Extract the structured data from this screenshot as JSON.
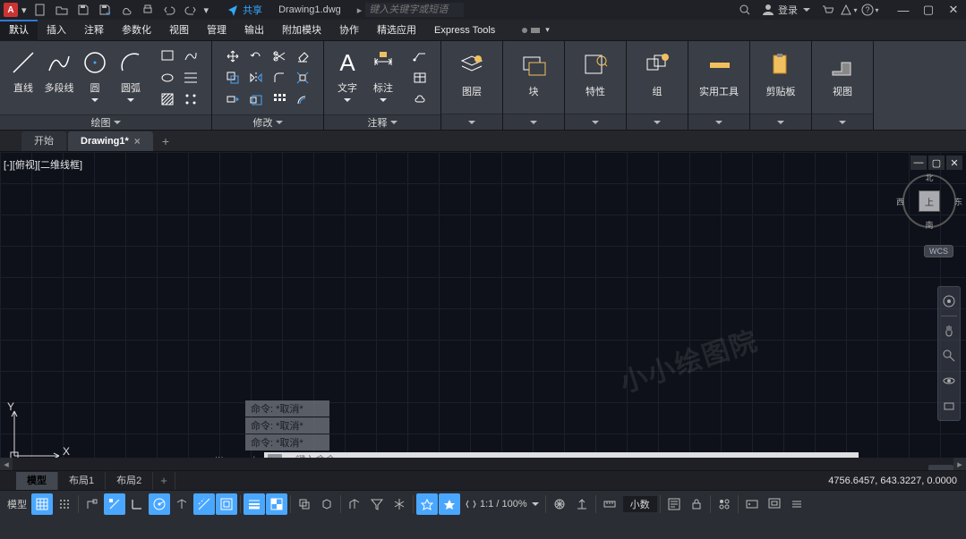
{
  "title": {
    "filename": "Drawing1.dwg",
    "share": "共享",
    "search_placeholder": "键入关键字或短语",
    "login": "登录"
  },
  "menu": {
    "tabs": [
      "默认",
      "插入",
      "注释",
      "参数化",
      "视图",
      "管理",
      "输出",
      "附加模块",
      "协作",
      "精选应用",
      "Express Tools"
    ],
    "active": 0
  },
  "ribbon": {
    "draw": {
      "title": "绘图",
      "btns": {
        "line": "直线",
        "polyline": "多段线",
        "circle": "圆",
        "arc": "圆弧"
      }
    },
    "modify": {
      "title": "修改"
    },
    "annot": {
      "title": "注释",
      "btns": {
        "text": "文字",
        "dim": "标注"
      }
    },
    "layers": {
      "title": "图层",
      "btn": "图层"
    },
    "block": {
      "title": "块",
      "btn": "块"
    },
    "props": {
      "title": "特性",
      "btn": "特性"
    },
    "group": {
      "title": "组",
      "btn": "组"
    },
    "util": {
      "title": "实用工具",
      "btn": "实用工具"
    },
    "clip": {
      "title": "剪贴板",
      "btn": "剪贴板"
    },
    "view": {
      "title": "视图",
      "btn": "视图"
    }
  },
  "filetabs": {
    "start": "开始",
    "drawing": "Drawing1*"
  },
  "viewport": {
    "label": "[-][俯视][二维线框]",
    "cube_face": "上",
    "wcs": "WCS",
    "cube": {
      "n": "北",
      "s": "南",
      "e": "东",
      "w": "西"
    }
  },
  "cmd": {
    "hist": [
      "命令: *取消*",
      "命令: *取消*",
      "命令: *取消*"
    ],
    "placeholder": "键入命令"
  },
  "layouts": {
    "model": "模型",
    "l1": "布局1",
    "l2": "布局2"
  },
  "coords": "4756.6457, 643.3227, 0.0000",
  "watermark": "小小绘图院",
  "status": {
    "model": "模型",
    "zoom": "1:1 / 100%",
    "decimal": "小数"
  }
}
